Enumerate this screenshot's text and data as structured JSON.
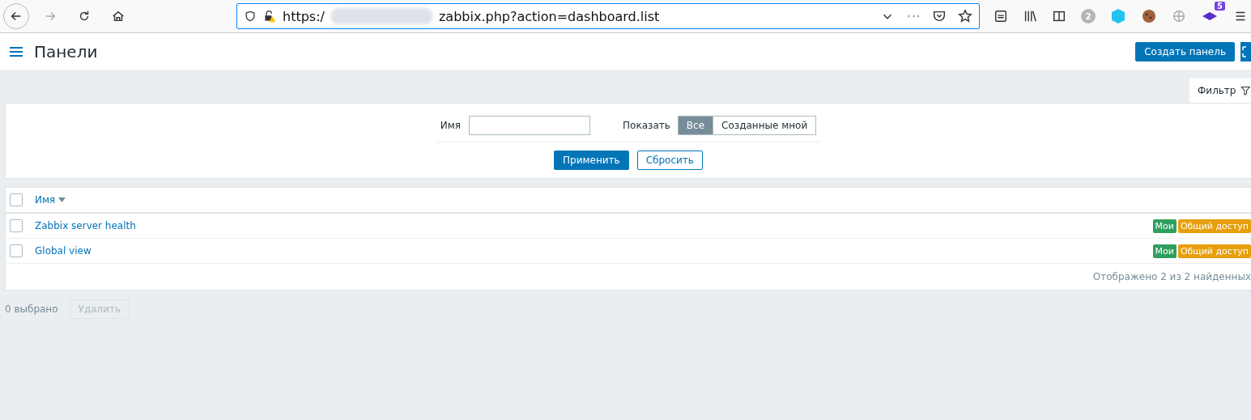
{
  "browser": {
    "url_prefix": "https:/",
    "url_suffix": "zabbix.php?action=dashboard.list",
    "extension_badges": [
      "2",
      "5"
    ]
  },
  "header": {
    "title": "Панели",
    "create_button": "Создать панель"
  },
  "filter": {
    "tab": "Фильтр",
    "name_label": "Имя",
    "show_label": "Показать",
    "show_options": [
      {
        "label": "Все",
        "selected": true
      },
      {
        "label": "Созданные мной",
        "selected": false
      }
    ],
    "apply": "Применить",
    "reset": "Сбросить"
  },
  "table": {
    "column": "Имя",
    "all_checked": false,
    "rows": [
      {
        "name": "Zabbix server health",
        "checked": false,
        "tags": [
          {
            "label": "Мои",
            "color": "#2f9f5f"
          },
          {
            "label": "Общий доступ",
            "color": "#e79f0e"
          }
        ]
      },
      {
        "name": "Global view",
        "checked": false,
        "tags": [
          {
            "label": "Мои",
            "color": "#2f9f5f"
          },
          {
            "label": "Общий доступ",
            "color": "#e79f0e"
          }
        ]
      }
    ],
    "footer": "Отображено 2 из 2 найденных"
  },
  "actions": {
    "selected_count": "0 выбрано",
    "delete": "Удалить",
    "delete_disabled": true
  }
}
